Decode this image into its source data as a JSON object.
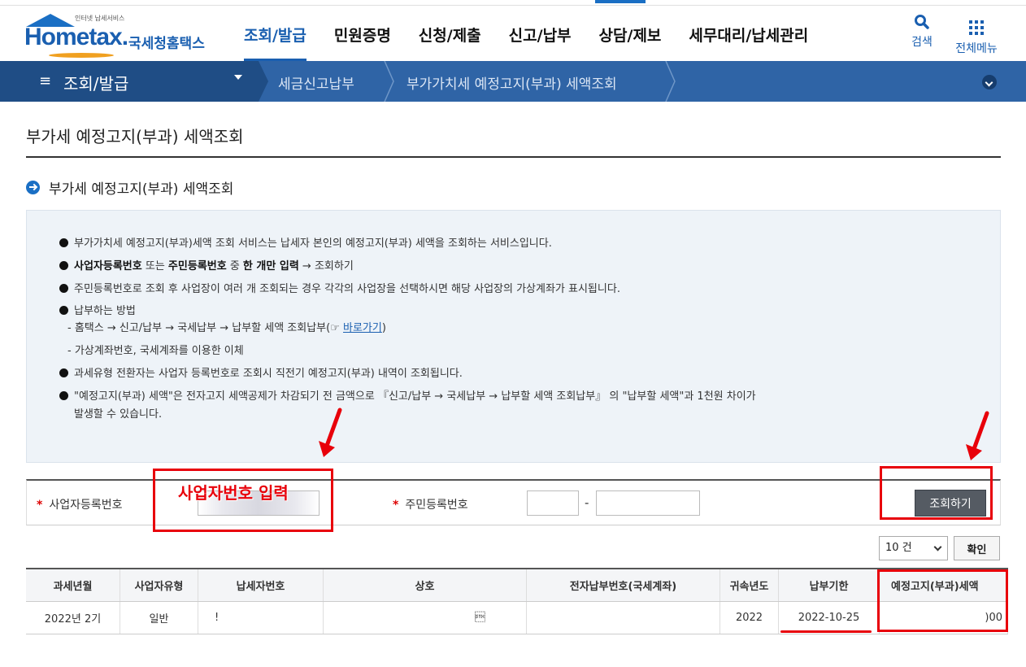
{
  "header": {
    "logo_small": "인터넷 납세서비스",
    "logo_en": "Hometax.",
    "logo_ko": "국세청홈택스",
    "nav": [
      "조회/발급",
      "민원증명",
      "신청/제출",
      "신고/납부",
      "상담/제보",
      "세무대리/납세관리"
    ],
    "search_label": "검색",
    "menu_label": "전체메뉴"
  },
  "breadcrumb": {
    "home": "조회/발급",
    "items": [
      "세금신고납부",
      "부가가치세 예정고지(부과) 세액조회"
    ]
  },
  "page": {
    "title": "부가세 예정고지(부과) 세액조회",
    "section_title": "부가세 예정고지(부과) 세액조회"
  },
  "info": {
    "line1": "부가가치세 예정고지(부과)세액 조회 서비스는 납세자 본인의 예정고지(부과) 세액을 조회하는 서비스입니다.",
    "line2_bold_a": "사업자등록번호",
    "line2_mid": " 또는 ",
    "line2_bold_b": "주민등록번호",
    "line2_mid2": " 중 ",
    "line2_bold_c": "한 개만 입력",
    "line2_tail": " → 조회하기",
    "line3": "주민등록번호로 조회 후 사업장이 여러 개 조회되는 경우 각각의 사업장을 선택하시면 해당 사업장의 가상계좌가 표시됩니다.",
    "line4": "납부하는 방법",
    "sub1_pre": "- 홈택스 → 신고/납부 → 국세납부 → 납부할 세액 조회납부(☞ ",
    "sub1_link": "바로가기",
    "sub1_post": ")",
    "sub2": "- 가상계좌번호, 국세계좌를 이용한 이체",
    "line5": "과세유형 전환자는 사업자 등록번호로 조회시 직전기 예정고지(부과) 내역이 조회됩니다.",
    "line6a": "\"예정고지(부과) 세액\"은 전자고지 세액공제가 차감되기 전 금액으로 『신고/납부 → 국세납부 → 납부할 세액 조회납부』 의 \"납부할 세액\"과 1천원 차이가",
    "line6b": "발생할 수 있습니다."
  },
  "form": {
    "required_mark": "*",
    "biz_label": "사업자등록번호",
    "rrn_label": "주민등록번호",
    "dash": "-",
    "query_button": "조회하기"
  },
  "pager": {
    "page_size": "10 건",
    "confirm": "확인"
  },
  "table": {
    "headers": [
      "과세년월",
      "사업자유형",
      "납세자번호",
      "상호",
      "전자납부번호(국세계좌)",
      "귀속년도",
      "납부기한",
      "예정고지(부과)세액"
    ],
    "rows": [
      [
        "2022년 2기",
        "일반",
        "!",
        "\u0002",
        "",
        "2022",
        "2022-10-25",
        ")00"
      ]
    ]
  },
  "annotation": {
    "input_hint": "사업자번호 입력",
    "color": "#e8000a"
  }
}
